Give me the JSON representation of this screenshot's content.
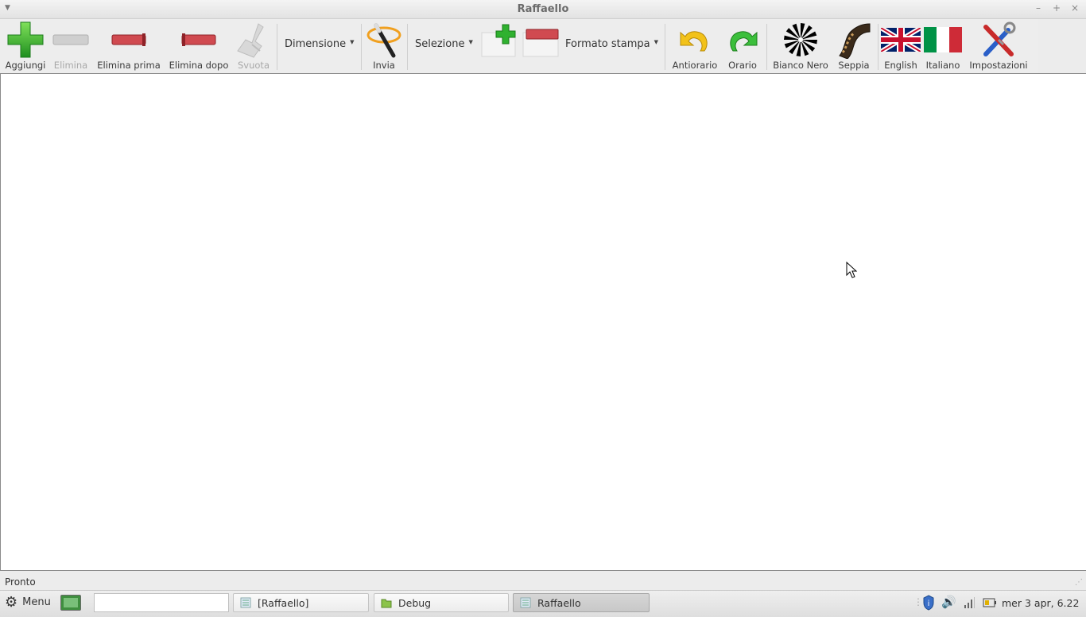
{
  "window": {
    "title": "Raffaello"
  },
  "toolbar": {
    "aggiungi": "Aggiungi",
    "elimina": "Elimina",
    "elimina_prima": "Elimina prima",
    "elimina_dopo": "Elimina dopo",
    "svuota": "Svuota",
    "dimensione": "Dimensione",
    "invia": "Invia",
    "selezione": "Selezione",
    "formato_stampa": "Formato stampa",
    "antiorario": "Antiorario",
    "orario": "Orario",
    "bianco_nero": "Bianco Nero",
    "seppia": "Seppia",
    "english": "English",
    "italiano": "Italiano",
    "impostazioni": "Impostazioni"
  },
  "icons": {
    "aggiungi": "plus-icon",
    "elimina": "minus-icon",
    "elimina_prima": "remove-before-icon",
    "elimina_dopo": "remove-after-icon",
    "svuota": "broom-icon",
    "invia": "magic-wand-icon",
    "add_page": "add-page-icon",
    "remove_page": "remove-page-icon",
    "antiorario": "rotate-ccw-icon",
    "orario": "rotate-cw-icon",
    "bianco_nero": "black-white-icon",
    "seppia": "film-strip-icon",
    "english": "uk-flag-icon",
    "italiano": "italy-flag-icon",
    "impostazioni": "tools-icon"
  },
  "statusbar": {
    "text": "Pronto"
  },
  "taskbar": {
    "menu": "Menu",
    "search_value": "",
    "tasks": [
      {
        "label": "[Raffaello]"
      },
      {
        "label": "Debug"
      },
      {
        "label": "Raffaello"
      }
    ],
    "clock": "mer  3 apr, 6.22"
  },
  "colors": {
    "green": "#2fb12f",
    "red": "#c8383e",
    "disabled_gray": "#b8b8b8",
    "orange": "#f0a020",
    "selected_task": "#cdcdcd"
  }
}
